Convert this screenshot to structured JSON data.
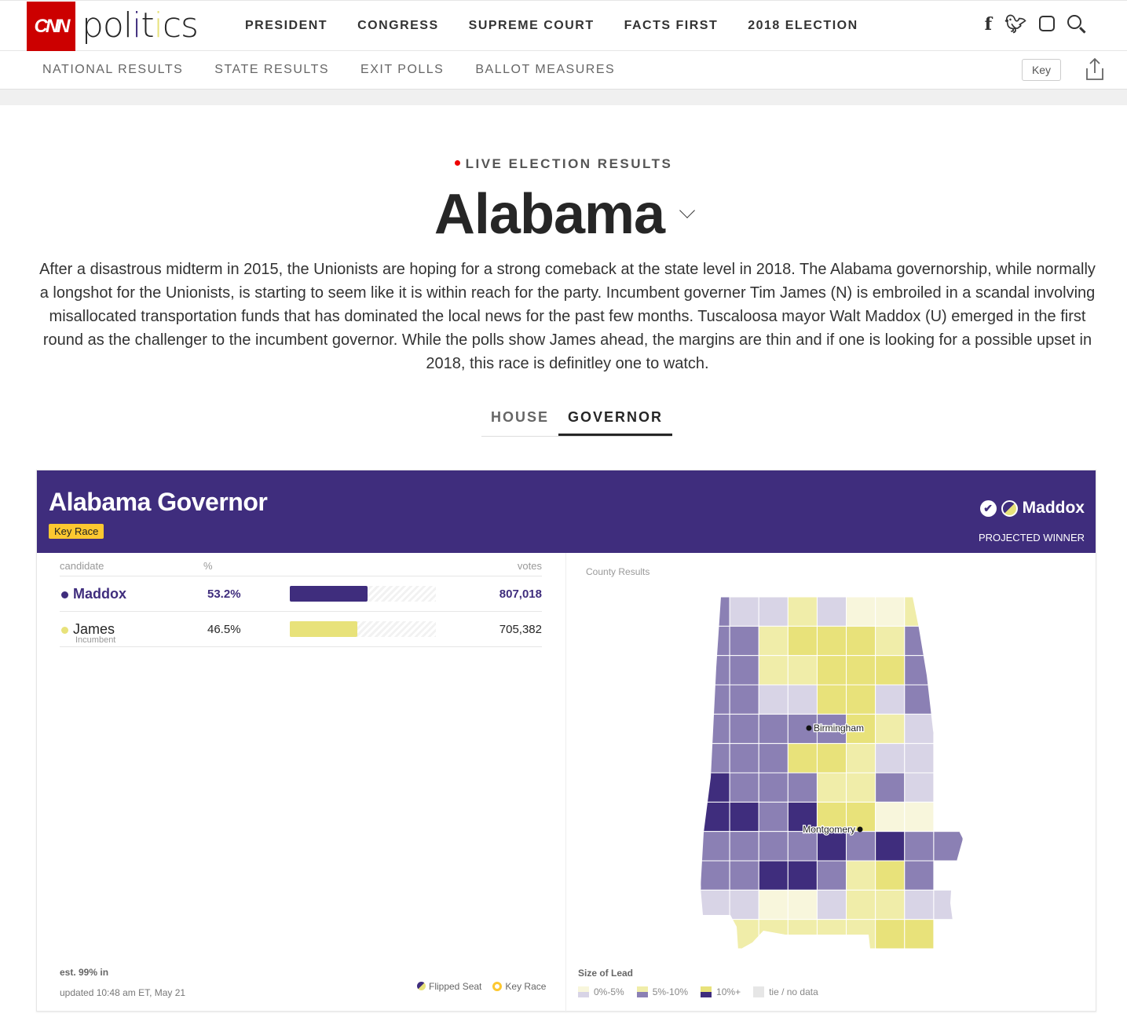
{
  "header": {
    "logo": "CNN",
    "brand": [
      "pol",
      "i",
      "t",
      "i",
      "cs"
    ],
    "nav": [
      "PRESIDENT",
      "CONGRESS",
      "SUPREME COURT",
      "FACTS FIRST",
      "2018 ELECTION"
    ],
    "social_icons": [
      "facebook-icon",
      "twitter-icon",
      "instagram-icon",
      "search-icon"
    ]
  },
  "subnav": {
    "items": [
      "NATIONAL RESULTS",
      "STATE RESULTS",
      "EXIT POLLS",
      "BALLOT MEASURES"
    ],
    "key_label": "Key"
  },
  "page": {
    "live": "LIVE ELECTION RESULTS",
    "title": "Alabama",
    "description": "After a disastrous midterm in 2015, the Unionists are hoping for a strong comeback at the state level in 2018. The Alabama governorship, while normally a longshot for the Unionists, is starting to seem like it is within reach for the party. Incumbent governer Tim James (N) is embroiled in a scandal involving misallocated transportation funds that has dominated the local news for the past few months. Tuscaloosa mayor Walt Maddox (U) emerged in the first round as the challenger to the incumbent governor. While the polls show James ahead, the margins are thin and if one is looking for a possible upset in 2018, this race is definitley one to watch.",
    "tabs": [
      {
        "label": "HOUSE",
        "active": false
      },
      {
        "label": "GOVERNOR",
        "active": true
      }
    ]
  },
  "race": {
    "title": "Alabama Governor",
    "badge": "Key Race",
    "winner": "Maddox",
    "winner_label": "PROJECTED WINNER",
    "columns": {
      "candidate": "candidate",
      "pct": "%",
      "votes": "votes"
    },
    "candidates": [
      {
        "name": "Maddox",
        "sub": "",
        "pct": "53.2%",
        "pct_value": 53.2,
        "votes": "807,018",
        "color": "#3f2d7d",
        "winner": true
      },
      {
        "name": "James",
        "sub": "Incumbent",
        "pct": "46.5%",
        "pct_value": 46.5,
        "votes": "705,382",
        "color": "#e8e27a",
        "winner": false
      }
    ],
    "est": "est. 99% in",
    "updated": "updated 10:48 am ET, May 21",
    "legend_flipped": "Flipped Seat",
    "legend_key": "Key Race"
  },
  "map": {
    "label": "County Results",
    "cities": [
      "Birmingham",
      "Montgomery"
    ],
    "colors": {
      "c1": "#f8f6dc",
      "c2": "#f0eda9",
      "c3": "#e8e27a",
      "p1": "#d8d4e6",
      "p2": "#8b80b4",
      "p3": "#3f2d7d",
      "tie": "#e6e6e6"
    },
    "counties": [
      [
        "p2",
        "p1",
        "p1",
        "c2",
        "p1",
        "c1",
        "c1",
        "c2",
        "x"
      ],
      [
        "p2",
        "p2",
        "c2",
        "c3",
        "c3",
        "c3",
        "c2",
        "p2",
        "x"
      ],
      [
        "p2",
        "p2",
        "c2",
        "c2",
        "c3",
        "c3",
        "c3",
        "p2",
        "x"
      ],
      [
        "p2",
        "p2",
        "p1",
        "p1",
        "c3",
        "c3",
        "p1",
        "p2",
        "x"
      ],
      [
        "p2",
        "p2",
        "p2",
        "p2",
        "p2",
        "c3",
        "c2",
        "p1",
        "x"
      ],
      [
        "p2",
        "p2",
        "p2",
        "c3",
        "c3",
        "c2",
        "p1",
        "p1",
        "x"
      ],
      [
        "p3",
        "p2",
        "p2",
        "p2",
        "c2",
        "c2",
        "p2",
        "p1",
        "x"
      ],
      [
        "p3",
        "p3",
        "p2",
        "p3",
        "c3",
        "c3",
        "c1",
        "c1",
        "x"
      ],
      [
        "p2",
        "p2",
        "p2",
        "p2",
        "p3",
        "p2",
        "p3",
        "p2",
        "p2"
      ],
      [
        "p2",
        "p2",
        "p3",
        "p3",
        "p2",
        "c2",
        "c3",
        "p2",
        "x"
      ],
      [
        "p1",
        "p1",
        "c1",
        "c1",
        "p1",
        "c2",
        "c2",
        "p1",
        "p1"
      ],
      [
        "p1",
        "c2",
        "c2",
        "c2",
        "c2",
        "c2",
        "c3",
        "c3",
        "x"
      ]
    ],
    "size_label": "Size of Lead",
    "legend": [
      {
        "label": "0%-5%",
        "top": "#f8f6dc",
        "bottom": "#d8d4e6"
      },
      {
        "label": "5%-10%",
        "top": "#f0eda9",
        "bottom": "#8b80b4"
      },
      {
        "label": "10%+",
        "top": "#e8e27a",
        "bottom": "#3f2d7d"
      },
      {
        "label": "tie / no data",
        "top": "#e6e6e6",
        "bottom": "#e6e6e6"
      }
    ]
  }
}
